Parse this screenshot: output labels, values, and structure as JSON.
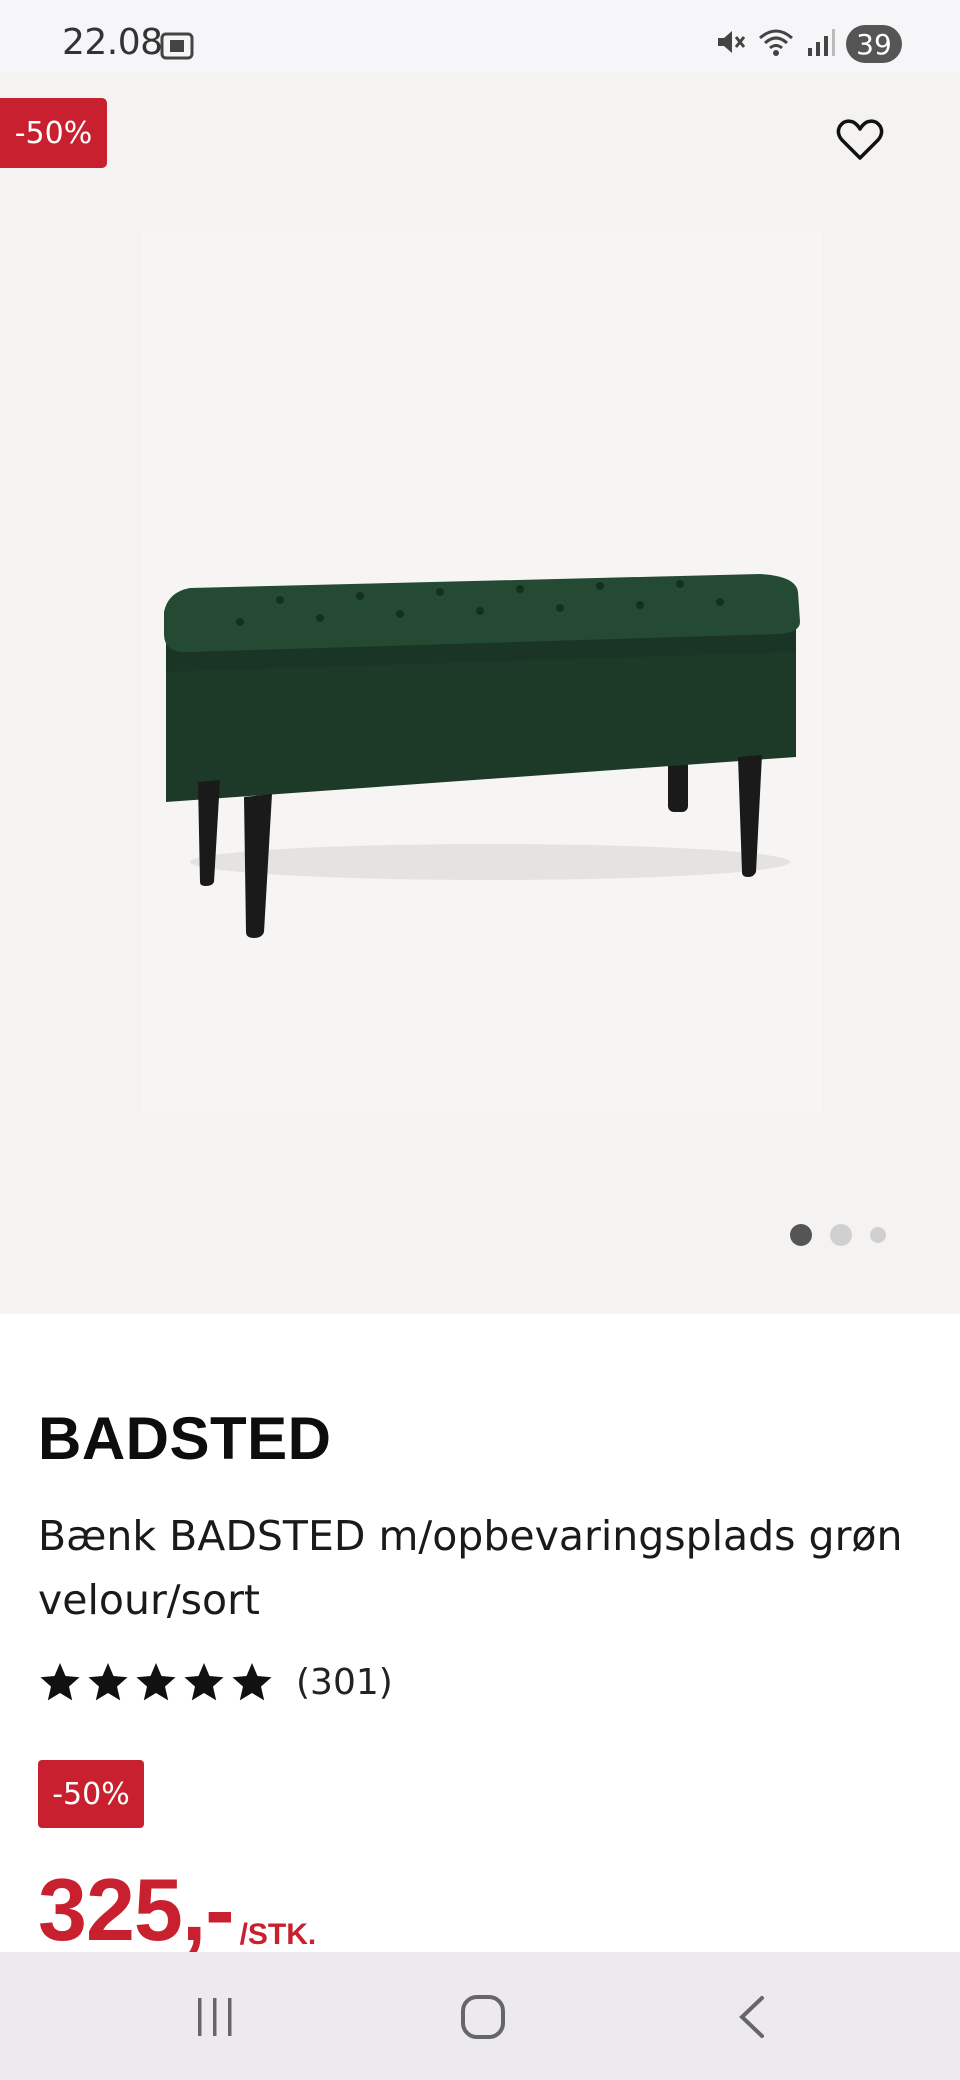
{
  "status_bar": {
    "time": "22.08",
    "battery": "39",
    "icons": [
      "screenshot-icon",
      "mute-icon",
      "wifi-icon",
      "signal-icon"
    ]
  },
  "gallery": {
    "discount_badge": "-50%",
    "favorite_icon": "heart-outline-icon",
    "slides": 3,
    "active_slide": 1
  },
  "product": {
    "brand": "BADSTED",
    "description": "Bænk BADSTED m/opbevaringsplads grøn velour/sort",
    "rating": 5,
    "review_count": "(301)",
    "discount_badge": "-50%",
    "price": "325,-",
    "unit": "/STK."
  },
  "colors": {
    "accent": "#c8202e",
    "bench_velvet": "#1f3d2a",
    "legs": "#1a1a1a"
  },
  "nav_bar": {
    "icons": [
      "recent-apps-icon",
      "home-icon",
      "back-icon"
    ]
  }
}
